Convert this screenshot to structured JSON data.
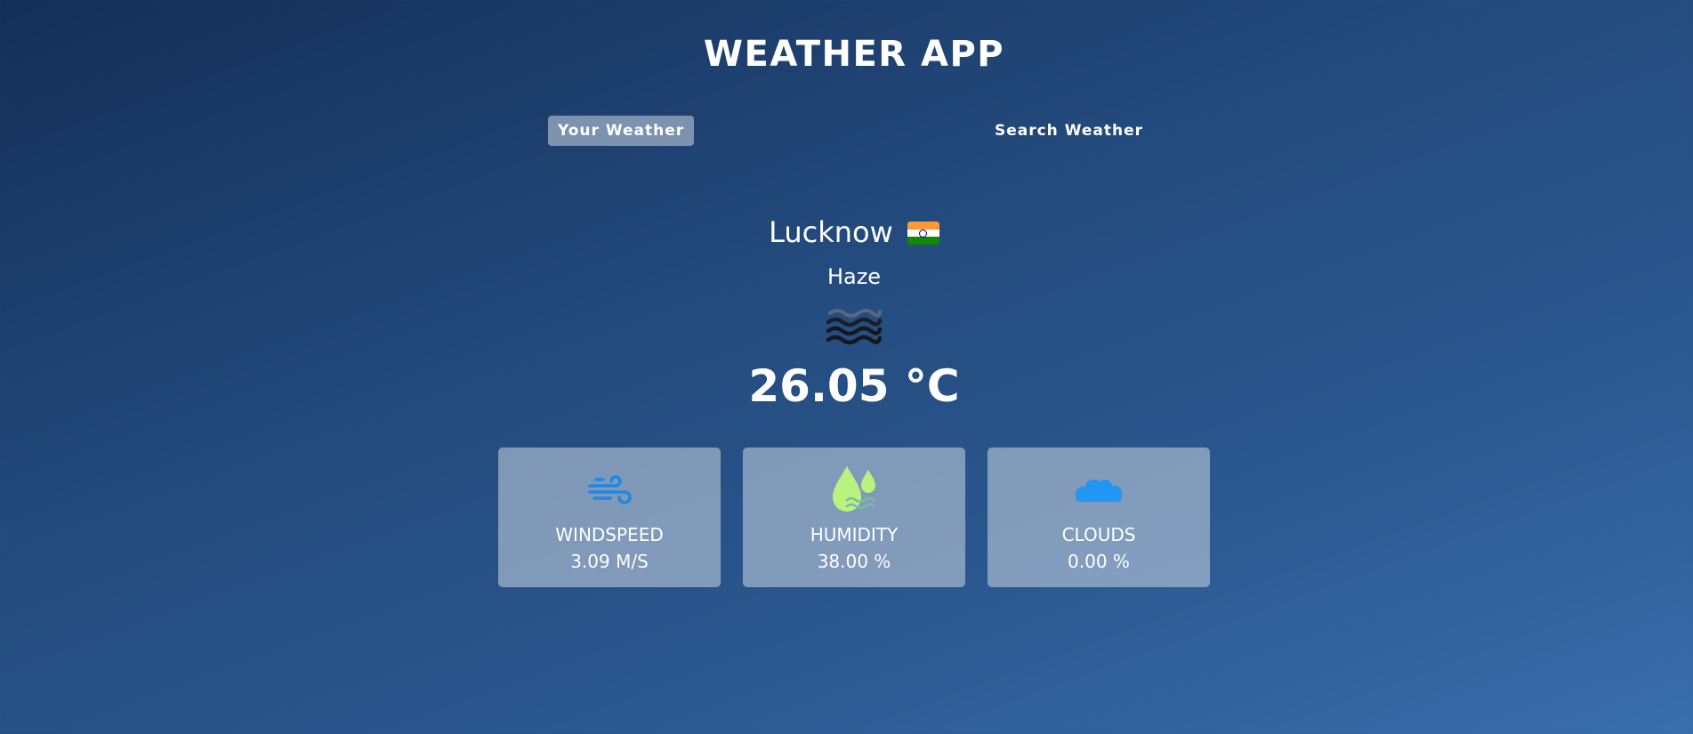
{
  "header": {
    "title": "WEATHER APP"
  },
  "tabs": {
    "your_weather": "Your Weather",
    "search_weather": "Search Weather",
    "active": "your_weather"
  },
  "weather": {
    "city": "Lucknow",
    "country_flag": "india-flag-icon",
    "description": "Haze",
    "condition_icon": "haze-icon",
    "temperature": "26.05 °C"
  },
  "stats": {
    "windspeed": {
      "label": "WINDSPEED",
      "value": "3.09 M/S",
      "icon": "wind-icon",
      "icon_color": "#1e88e5"
    },
    "humidity": {
      "label": "HUMIDITY",
      "value": "38.00 %",
      "icon": "humidity-icon",
      "icon_color": "#b9f27c"
    },
    "clouds": {
      "label": "CLOUDS",
      "value": "0.00 %",
      "icon": "cloud-icon",
      "icon_color": "#2196f3"
    }
  },
  "colors": {
    "background_start": "#142f57",
    "background_end": "#3a6eac",
    "card_background": "rgba(203,213,225,0.55)",
    "text": "#ffffff"
  }
}
